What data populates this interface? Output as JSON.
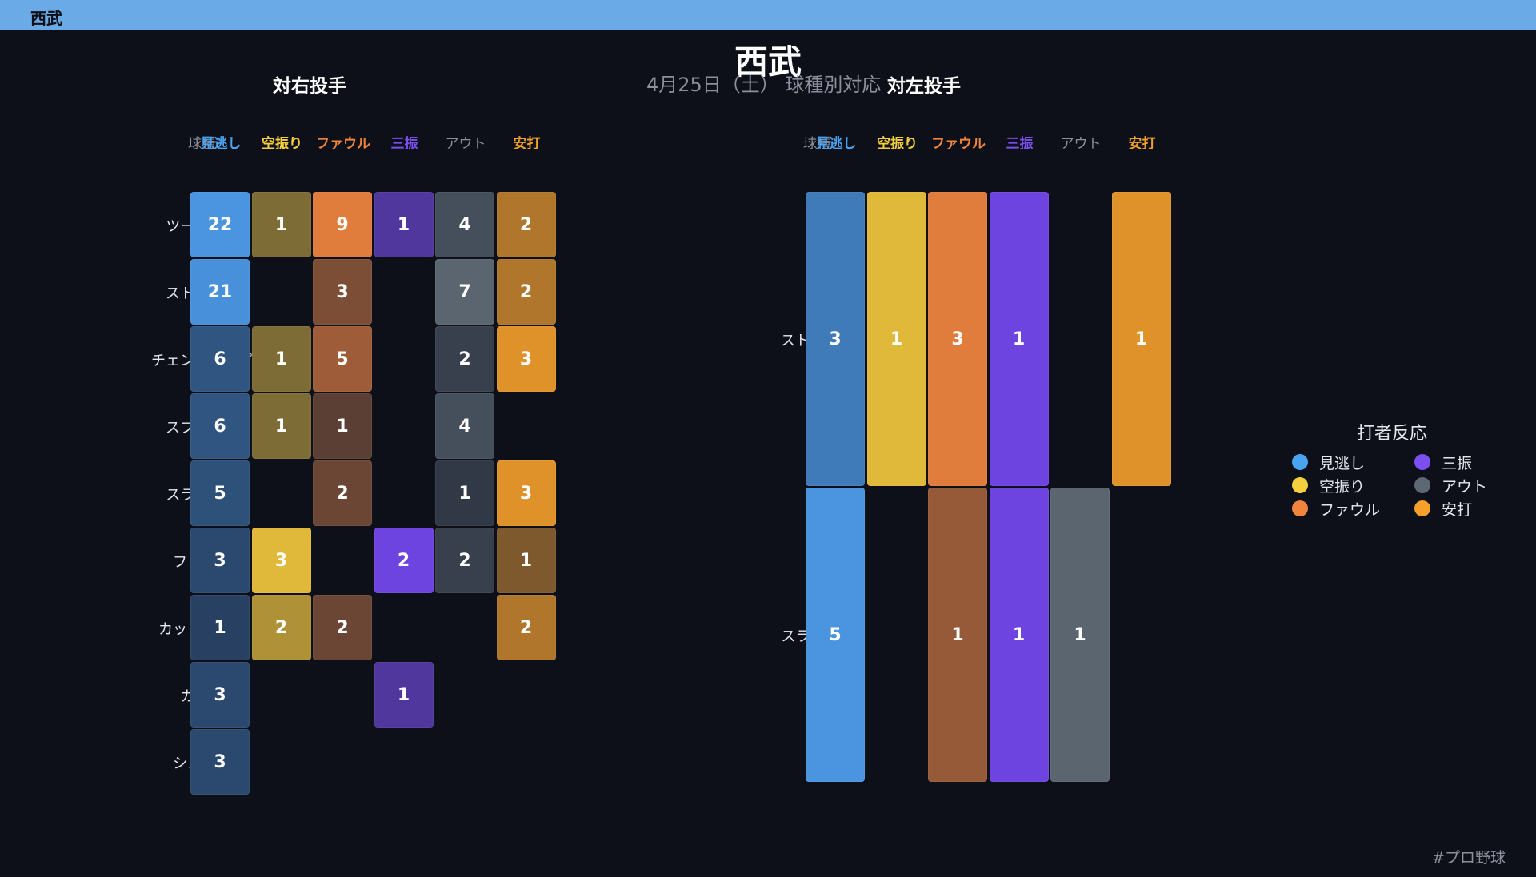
{
  "header": {
    "tab_label": "西武"
  },
  "title": "西武",
  "subtitle": "4月25日（土） 球種別対応",
  "footer": "#プロ野球",
  "column_header_label": "球種",
  "legend": {
    "title": "打者反応",
    "items": [
      {
        "label": "見逃し",
        "color": "#4aa3f0"
      },
      {
        "label": "三振",
        "color": "#7c4ff0"
      },
      {
        "label": "空振り",
        "color": "#f6cf3c"
      },
      {
        "label": "アウト",
        "color": "#5e6875"
      },
      {
        "label": "ファウル",
        "color": "#f0843c"
      },
      {
        "label": "安打",
        "color": "#f4a02a"
      }
    ]
  },
  "chart_data": [
    {
      "type": "heatmap",
      "title": "対右投手",
      "categories": [
        "見逃し",
        "空振り",
        "ファウル",
        "三振",
        "アウト",
        "安打"
      ],
      "category_colors": [
        "#4aa3f0",
        "#f6cf3c",
        "#f0843c",
        "#7c4ff0",
        "#8b909c",
        "#f4a02a"
      ],
      "rows": [
        "ツーシーム",
        "ストレート",
        "チェンジアップ",
        "スプリット",
        "スライダー",
        "フォーク",
        "カットボール",
        "カーブ",
        "シュート"
      ],
      "values": [
        [
          22,
          1,
          9,
          1,
          4,
          2
        ],
        [
          21,
          null,
          3,
          null,
          7,
          2
        ],
        [
          6,
          1,
          5,
          null,
          2,
          3
        ],
        [
          6,
          1,
          1,
          null,
          4,
          null
        ],
        [
          5,
          null,
          2,
          null,
          1,
          3
        ],
        [
          3,
          3,
          null,
          2,
          2,
          1
        ],
        [
          1,
          2,
          2,
          null,
          null,
          2
        ],
        [
          3,
          null,
          null,
          1,
          null,
          null
        ],
        [
          3,
          null,
          null,
          null,
          null,
          null
        ]
      ]
    },
    {
      "type": "heatmap",
      "title": "対左投手",
      "categories": [
        "見逃し",
        "空振り",
        "ファウル",
        "三振",
        "アウト",
        "安打"
      ],
      "category_colors": [
        "#4aa3f0",
        "#f6cf3c",
        "#f0843c",
        "#7c4ff0",
        "#8b909c",
        "#f4a02a"
      ],
      "rows": [
        "ストレート",
        "スライダー"
      ],
      "values": [
        [
          3,
          1,
          3,
          1,
          null,
          1
        ],
        [
          5,
          null,
          1,
          1,
          1,
          null
        ]
      ]
    }
  ]
}
